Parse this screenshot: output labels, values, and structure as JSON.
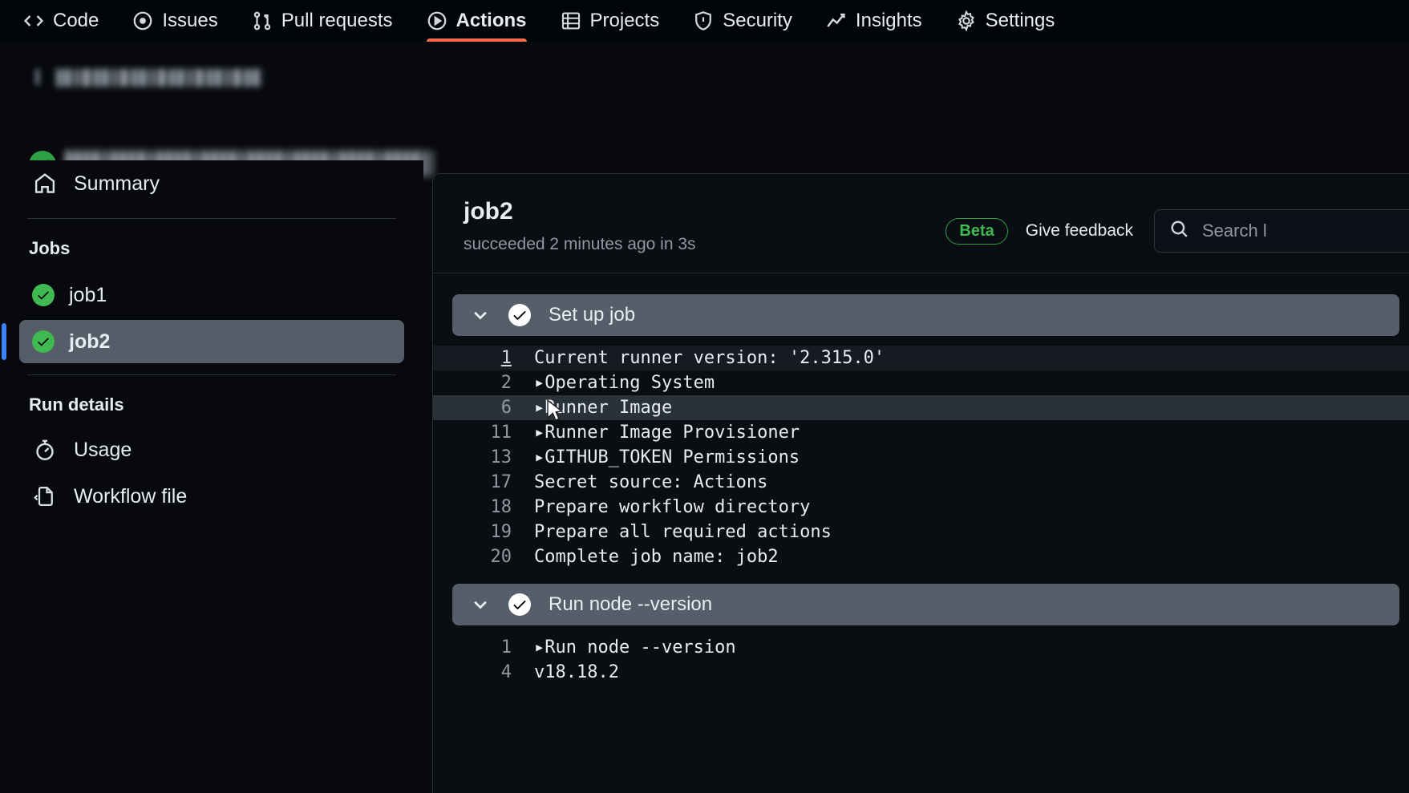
{
  "topnav": {
    "items": [
      {
        "label": "Code",
        "icon": "code-icon",
        "active": false
      },
      {
        "label": "Issues",
        "icon": "issue-opened-icon",
        "active": false
      },
      {
        "label": "Pull requests",
        "icon": "git-pull-request-icon",
        "active": false
      },
      {
        "label": "Actions",
        "icon": "play-icon",
        "active": true
      },
      {
        "label": "Projects",
        "icon": "table-icon",
        "active": false
      },
      {
        "label": "Security",
        "icon": "shield-icon",
        "active": false
      },
      {
        "label": "Insights",
        "icon": "graph-icon",
        "active": false
      },
      {
        "label": "Settings",
        "icon": "gear-icon",
        "active": false
      }
    ],
    "active_accent": "#fd6b4a"
  },
  "run_header": {
    "run_number": "[redacted]",
    "workflow_name": "[redacted]",
    "run_title": "[redacted]",
    "status": "success",
    "status_color": "#2ea043"
  },
  "sidebar": {
    "summary": {
      "label": "Summary",
      "icon": "home-icon"
    },
    "jobs_heading": "Jobs",
    "jobs": [
      {
        "label": "job1",
        "status": "success",
        "selected": false
      },
      {
        "label": "job2",
        "status": "success",
        "selected": true
      }
    ],
    "run_details_heading": "Run details",
    "run_details": [
      {
        "label": "Usage",
        "icon": "stopwatch-icon"
      },
      {
        "label": "Workflow file",
        "icon": "file-code-icon"
      }
    ],
    "selected_bg": "#545d68",
    "selected_marker": "#3b82f6",
    "success_color": "#3fb950"
  },
  "main": {
    "job_title": "job2",
    "job_subtitle": "succeeded 2 minutes ago in 3s",
    "beta_badge": "Beta",
    "feedback_label": "Give feedback",
    "search": {
      "placeholder": "Search l",
      "value": "",
      "icon": "search-icon"
    },
    "steps": [
      {
        "name": "Set up job",
        "status": "success",
        "expanded": true,
        "chevron": "chevron-down-icon",
        "lines": [
          {
            "num": "1",
            "text": "Current runner version: '2.315.0'",
            "group": false,
            "highlight": "first"
          },
          {
            "num": "2",
            "text": "Operating System",
            "group": true,
            "highlight": "none"
          },
          {
            "num": "6",
            "text": "Runner Image",
            "group": true,
            "highlight": "hover"
          },
          {
            "num": "11",
            "text": "Runner Image Provisioner",
            "group": true,
            "highlight": "none"
          },
          {
            "num": "13",
            "text": "GITHUB_TOKEN Permissions",
            "group": true,
            "highlight": "none"
          },
          {
            "num": "17",
            "text": "Secret source: Actions",
            "group": false,
            "highlight": "none"
          },
          {
            "num": "18",
            "text": "Prepare workflow directory",
            "group": false,
            "highlight": "none"
          },
          {
            "num": "19",
            "text": "Prepare all required actions",
            "group": false,
            "highlight": "none"
          },
          {
            "num": "20",
            "text": "Complete job name: job2",
            "group": false,
            "highlight": "none"
          }
        ]
      },
      {
        "name": "Run node --version",
        "status": "success",
        "expanded": true,
        "chevron": "chevron-down-icon",
        "lines": [
          {
            "num": "1",
            "text": "Run node --version",
            "group": true,
            "highlight": "none"
          },
          {
            "num": "4",
            "text": "v18.18.2",
            "group": false,
            "highlight": "none"
          }
        ]
      }
    ]
  }
}
